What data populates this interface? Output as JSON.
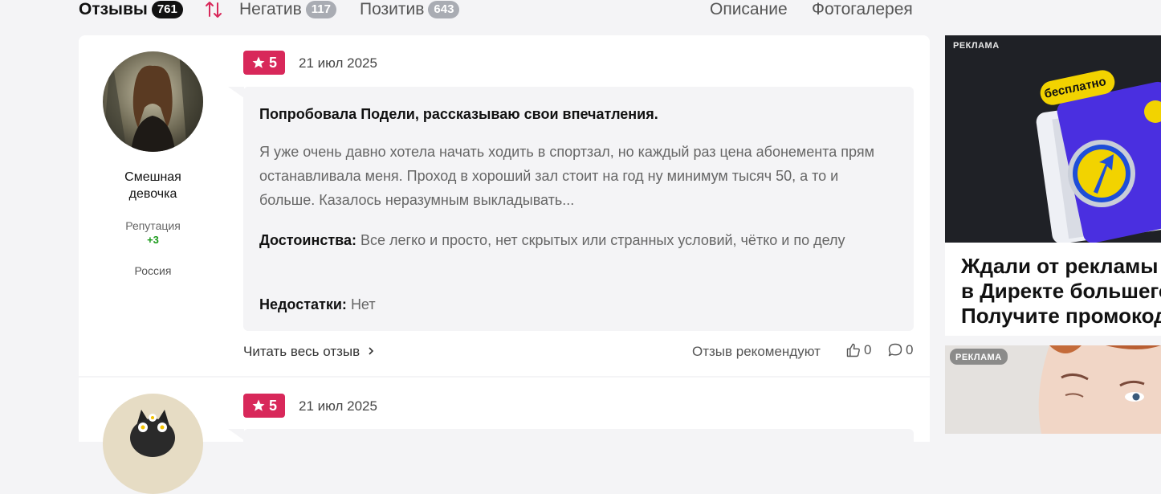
{
  "tabs": {
    "reviews": {
      "label": "Отзывы",
      "count": "761"
    },
    "negative": {
      "label": "Негатив",
      "count": "117"
    },
    "positive": {
      "label": "Позитив",
      "count": "643"
    },
    "description": "Описание",
    "gallery": "Фотогалерея"
  },
  "colors": {
    "accent": "#d8285a",
    "positive_rep": "#1a9a1a",
    "ad_badge": "#f2d300"
  },
  "reviews": [
    {
      "author": "Смешная девочка",
      "reputation_label": "Репутация",
      "reputation_value": "+3",
      "country": "Россия",
      "rating": "5",
      "date": "21 июл 2025",
      "title": "Попробовала Подели, рассказываю свои впечатления.",
      "text": "Я уже очень давно хотела начать ходить в спортзал, но каждый раз цена абонемента прям останавливала меня. Проход в хороший зал стоит на год ну минимум тысяч 50, а то и больше. Казалось неразумным выкладывать...",
      "pros_label": "Достоинства:",
      "pros": "Все легко и просто, нет скрытых или странных условий, чётко и по делу",
      "cons_label": "Недостатки:",
      "cons": "Нет",
      "read_more": "Читать весь отзыв",
      "recommend": "Отзыв рекомендуют",
      "likes": "0",
      "comments": "0"
    },
    {
      "rating": "5",
      "date": "21 июл 2025"
    }
  ],
  "ads": [
    {
      "label": "РЕКЛАМА",
      "badge": "бесплатно",
      "text_lines": [
        "Ждали от рекламы",
        "в Директе большего",
        "Получите промокод"
      ]
    },
    {
      "label": "РЕКЛАМА"
    }
  ]
}
